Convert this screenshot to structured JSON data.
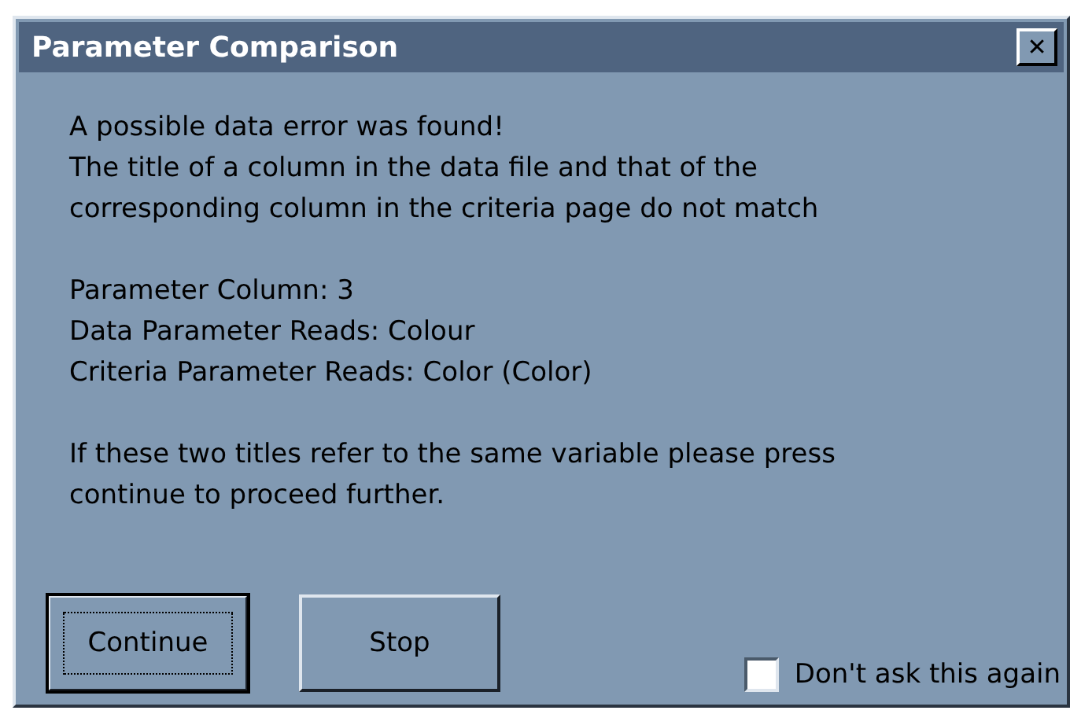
{
  "window": {
    "title": "Parameter Comparison",
    "close": "✕"
  },
  "message": {
    "paragraphs": [
      [
        "A possible data error was found!",
        "The title of a column in the data file and that of the",
        "corresponding column in the criteria page do not match"
      ],
      [
        "Parameter Column: 3",
        "Data Parameter Reads: Colour",
        "Criteria Parameter Reads: Color (Color)"
      ],
      [
        "If these two titles refer to the same variable please press",
        "continue to proceed further."
      ]
    ]
  },
  "buttons": [
    {
      "label": "Continue",
      "default": true
    },
    {
      "label": "Stop",
      "default": false
    }
  ],
  "checkbox": {
    "label": "Don't ask this again",
    "checked": false
  }
}
